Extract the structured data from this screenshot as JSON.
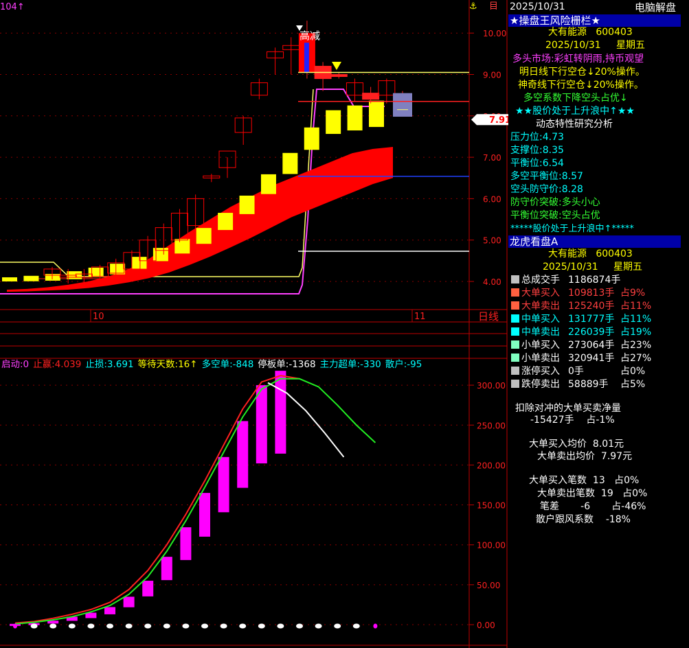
{
  "topbar": {
    "date": "2025/10/31",
    "title": "电脑解盘",
    "left_fragment": "104↑",
    "anchor_icon": "⚓",
    "scroll_icon": "目"
  },
  "colors": {
    "red": "#ff0000",
    "yellow": "#ffff00",
    "magenta": "#ff00ff",
    "green": "#22ee22",
    "white": "#ffffff",
    "blue": "#0000cc",
    "grid": "#8b0000"
  },
  "main_chart": {
    "annotation_top": "高减",
    "current_price_label": "7.91",
    "price_axis_ticks": [
      "10.00",
      "9.00",
      "8.00",
      "7.00",
      "6.00",
      "5.00",
      "4.00"
    ],
    "x_labels": [
      "10",
      "11"
    ],
    "period_label": "日线"
  },
  "indicator_chart": {
    "legend": [
      {
        "text": "启动:0",
        "color": "#ff40ff"
      },
      {
        "text": "止赢:4.039",
        "color": "#ff2020"
      },
      {
        "text": "止损:3.691",
        "color": "#00ffff"
      },
      {
        "text": "等待天数:16↑",
        "color": "#ffff00"
      },
      {
        "text": "多空单:-848",
        "color": "#00ffff"
      },
      {
        "text": "停板单:-1368",
        "color": "#ffffff"
      },
      {
        "text": "主力超单:-330",
        "color": "#00ffff"
      },
      {
        "text": "散户:-95",
        "color": "#00ffff"
      }
    ],
    "axis_ticks": [
      "300.00",
      "250.00",
      "200.00",
      "150.00",
      "100.00",
      "50.00",
      "0.00"
    ]
  },
  "chart_data": [
    {
      "type": "candlestick",
      "title": "",
      "y_range": [
        3.7,
        10.7
      ],
      "x_labels": [
        "10",
        "11"
      ],
      "candles": [
        {
          "o": 4.15,
          "h": 4.35,
          "l": 4.05,
          "c": 4.3
        },
        {
          "o": 4.1,
          "h": 4.3,
          "l": 3.95,
          "c": 4.15
        },
        {
          "o": 4.1,
          "h": 4.3,
          "l": 3.98,
          "c": 4.18
        },
        {
          "o": 4.12,
          "h": 4.4,
          "l": 4.05,
          "c": 4.35
        },
        {
          "o": 4.2,
          "h": 4.55,
          "l": 4.1,
          "c": 4.45
        },
        {
          "o": 4.3,
          "h": 4.75,
          "l": 4.2,
          "c": 4.7
        },
        {
          "o": 4.5,
          "h": 5.1,
          "l": 4.4,
          "c": 5.0
        },
        {
          "o": 4.75,
          "h": 5.4,
          "l": 4.65,
          "c": 5.3
        },
        {
          "o": 5.0,
          "h": 5.75,
          "l": 4.95,
          "c": 5.65
        },
        {
          "o": 5.35,
          "h": 6.1,
          "l": 5.25,
          "c": 6.0
        },
        {
          "o": 6.5,
          "h": 6.6,
          "l": 6.4,
          "c": 6.55
        },
        {
          "o": 6.75,
          "h": 7.0,
          "l": 6.5,
          "c": 7.15
        },
        {
          "o": 7.6,
          "h": 8.0,
          "l": 7.3,
          "c": 7.95
        },
        {
          "o": 8.5,
          "h": 8.9,
          "l": 8.4,
          "c": 8.8
        },
        {
          "o": 9.4,
          "h": 9.65,
          "l": 9.0,
          "c": 9.55
        },
        {
          "o": 9.6,
          "h": 9.9,
          "l": 9.0,
          "c": 9.7
        },
        {
          "o": 10.0,
          "h": 10.3,
          "l": 8.9,
          "c": 9.05
        },
        {
          "o": 9.2,
          "h": 9.3,
          "l": 8.6,
          "c": 8.9
        },
        {
          "o": 9.0,
          "h": 9.05,
          "l": 8.9,
          "c": 8.95
        },
        {
          "o": 8.5,
          "h": 8.9,
          "l": 8.35,
          "c": 8.8
        },
        {
          "o": 8.55,
          "h": 8.7,
          "l": 8.3,
          "c": 8.4
        },
        {
          "o": 8.5,
          "h": 8.9,
          "l": 8.3,
          "c": 8.85
        },
        {
          "o": 8.3,
          "h": 8.6,
          "l": 7.98,
          "c": 8.0
        }
      ],
      "yellow_steps": [
        4.05,
        4.07,
        4.1,
        4.15,
        4.22,
        4.3,
        4.45,
        4.65,
        4.85,
        5.1,
        5.45,
        5.85,
        6.35,
        6.85,
        7.45,
        7.85,
        7.95,
        8.05
      ],
      "band_upper": [
        3.8,
        3.82,
        3.86,
        3.92,
        4.0,
        4.12,
        4.3,
        4.55,
        4.88,
        5.2,
        5.5,
        5.8,
        6.05,
        6.3,
        6.5,
        6.7,
        6.9,
        7.1,
        7.2,
        7.25
      ],
      "band_lower": [
        3.75,
        3.76,
        3.78,
        3.8,
        3.84,
        3.9,
        3.98,
        4.08,
        4.22,
        4.4,
        4.6,
        4.82,
        5.05,
        5.3,
        5.55,
        5.75,
        5.95,
        6.15,
        6.35,
        6.5
      ],
      "horizontal_lines": [
        {
          "price": 8.35,
          "color": "#ff2020"
        },
        {
          "price": 9.05,
          "color": "#ffff66"
        },
        {
          "price": 6.54,
          "color": "#2040ff"
        },
        {
          "price": 4.73,
          "color": "#ffffff"
        }
      ],
      "current_price": 7.91
    },
    {
      "type": "bar+line",
      "title": "",
      "y_range": [
        0,
        320
      ],
      "bars": [
        1,
        2,
        5,
        10,
        15,
        22,
        35,
        55,
        85,
        122,
        165,
        210,
        255,
        300,
        318
      ],
      "line_green": [
        1,
        3,
        6,
        10,
        16,
        24,
        38,
        60,
        92,
        130,
        172,
        216,
        260,
        295,
        308,
        308,
        298,
        275,
        250,
        228
      ],
      "line_red": [
        2,
        4,
        8,
        13,
        19,
        28,
        44,
        68,
        100,
        138,
        180,
        225,
        270,
        304,
        312,
        308
      ],
      "line_white": [
        303,
        290,
        268,
        240,
        210
      ],
      "dots": 20
    }
  ],
  "panel": {
    "risk_header": "★操盘王风险栅栏★",
    "stock_name": "大有能源",
    "stock_code": "600403",
    "date": "2025/10/31",
    "weekday": "星期五",
    "market_status": "多头市场:彩虹转阴雨,持币观望",
    "line1": "明日线下行空仓↓20%操作。",
    "line2": "神奇线下行空仓↓20%操作。",
    "line3": "多空系数下降空头占优↓",
    "line4": "★★股价处于上升浪中↑★★",
    "dynamic_title": "动态特性研究分析",
    "pressure_label": "压力位:",
    "pressure_value": "4.73",
    "support_label": "支撑位:",
    "support_value": "8.35",
    "balance_label": "平衡位:",
    "balance_value": "6.54",
    "ls_balance_label": "多空平衡位:",
    "ls_balance_value": "8.57",
    "short_guard_label": "空头防守价:",
    "short_guard_value": "8.28",
    "guard_break": "防守价突破:多头小心",
    "balance_break": "平衡位突破:空头占优",
    "wave_line": "*****股价处于上升浪中↑*****",
    "lh_header": "龙虎看盘A",
    "lh_rows": [
      {
        "sq": "#c0c0c0",
        "label": "总成交手",
        "label_color": "#ffffff",
        "value": "1186874手",
        "value_color": "#ffffff",
        "pct": "",
        "pct_color": "#ffffff"
      },
      {
        "sq": "#ff6040",
        "label": "大单买入",
        "label_color": "#ff4040",
        "value": "109813手",
        "value_color": "#ff4040",
        "pct": "占9%",
        "pct_color": "#ff4040"
      },
      {
        "sq": "#ff6040",
        "label": "大单卖出",
        "label_color": "#ff4040",
        "value": "125240手",
        "value_color": "#ff4040",
        "pct": "占11%",
        "pct_color": "#ff4040"
      },
      {
        "sq": "#00ffff",
        "label": "中单买入",
        "label_color": "#00ffff",
        "value": "131777手",
        "value_color": "#00ffff",
        "pct": "占11%",
        "pct_color": "#00ffff"
      },
      {
        "sq": "#00ffff",
        "label": "中单卖出",
        "label_color": "#00ffff",
        "value": "226039手",
        "value_color": "#00ffff",
        "pct": "占19%",
        "pct_color": "#00ffff"
      },
      {
        "sq": "#80ffc0",
        "label": "小单买入",
        "label_color": "#ffffff",
        "value": "273064手",
        "value_color": "#ffffff",
        "pct": "占23%",
        "pct_color": "#ffffff"
      },
      {
        "sq": "#80ffc0",
        "label": "小单卖出",
        "label_color": "#ffffff",
        "value": "320941手",
        "value_color": "#ffffff",
        "pct": "占27%",
        "pct_color": "#ffffff"
      },
      {
        "sq": "#c0c0c0",
        "label": "涨停买入",
        "label_color": "#ffffff",
        "value": "0手",
        "value_color": "#ffffff",
        "pct": "占0%",
        "pct_color": "#ffffff"
      },
      {
        "sq": "#c0c0c0",
        "label": "跌停卖出",
        "label_color": "#ffffff",
        "value": "58889手",
        "value_color": "#ffffff",
        "pct": "占5%",
        "pct_color": "#ffffff"
      }
    ],
    "net_title": "扣除对冲的大单买卖净量",
    "net_value": "-15427手",
    "net_pct": "占-1%",
    "avg_buy_label": "大单买入均价",
    "avg_buy_value": "8.01元",
    "avg_sell_label": "大单卖出均价",
    "avg_sell_value": "7.97元",
    "cnt_buy_label": "大单买入笔数",
    "cnt_buy_value": "13",
    "cnt_buy_pct": "占0%",
    "cnt_sell_label": "大单卖出笔数",
    "cnt_sell_value": "19",
    "cnt_sell_pct": "占0%",
    "diff_label": "笔差",
    "diff_value": "-6",
    "diff_pct": "占-46%",
    "retail_label": "散户跟风系数",
    "retail_value": "-18%"
  }
}
